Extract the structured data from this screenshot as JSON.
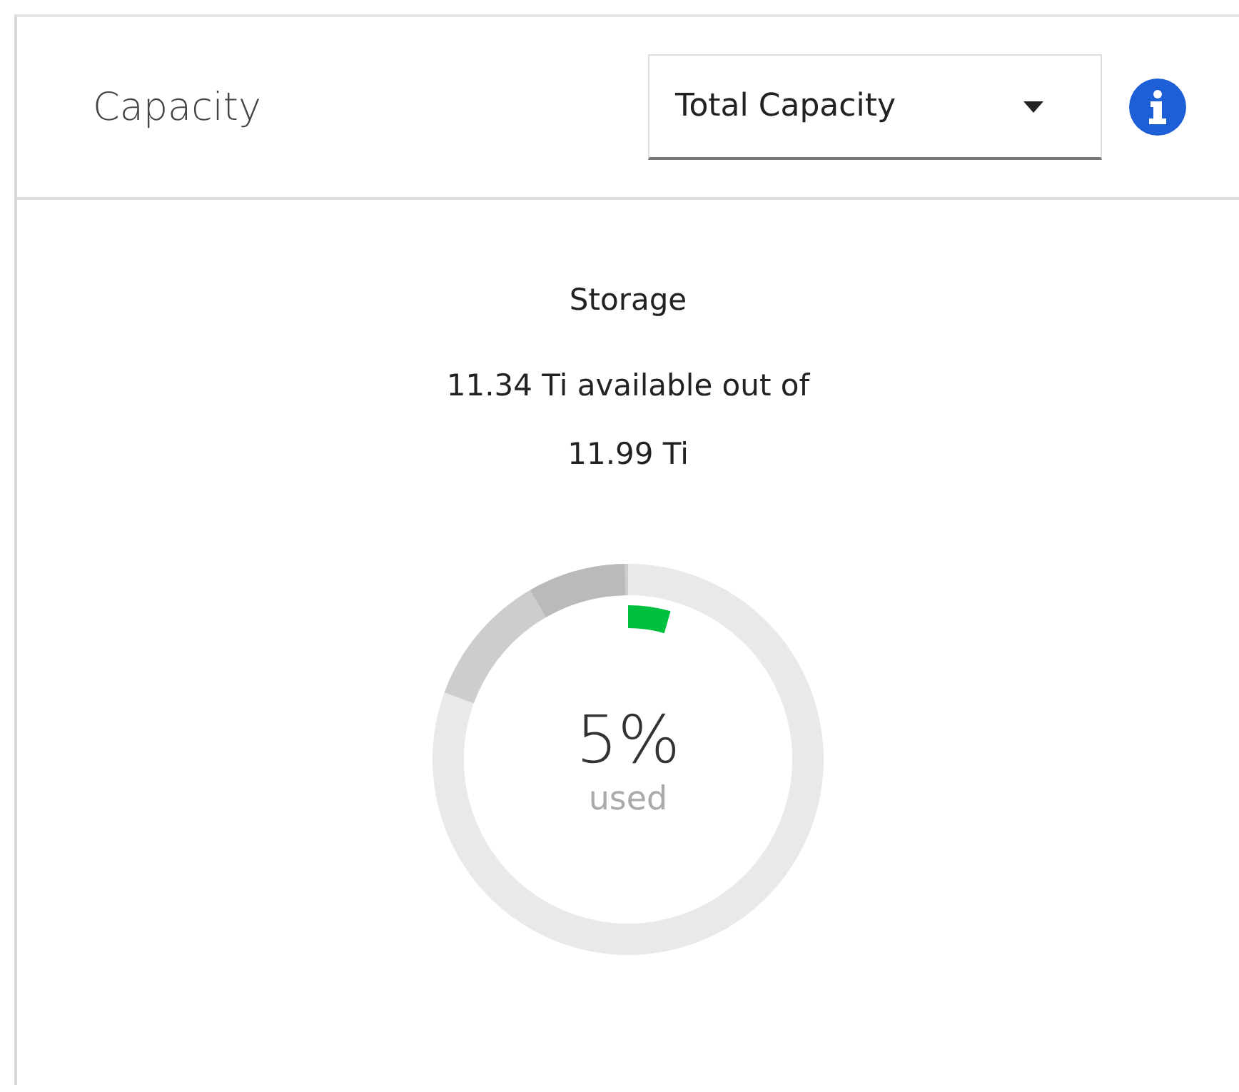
{
  "card": {
    "title": "Capacity",
    "dropdown": {
      "value": "Total Capacity"
    },
    "storage": {
      "heading": "Storage",
      "summary": "11.34 Ti available out of 11.99 Ti",
      "gauge": {
        "percent": "5%",
        "caption": "used"
      }
    }
  }
}
